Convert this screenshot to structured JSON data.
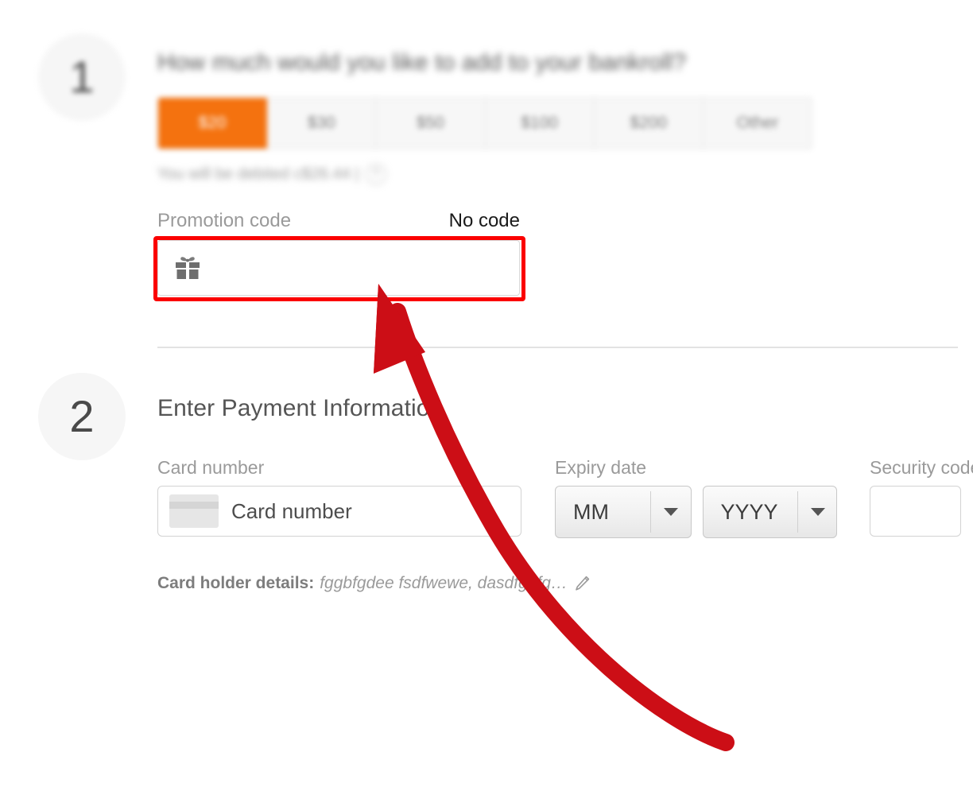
{
  "steps": [
    {
      "number": "1",
      "title": "How much would you like to add to your bankroll?",
      "amounts": [
        {
          "label": "$20",
          "selected": true
        },
        {
          "label": "$30",
          "selected": false
        },
        {
          "label": "$50",
          "selected": false
        },
        {
          "label": "$100",
          "selected": false
        },
        {
          "label": "$200",
          "selected": false
        },
        {
          "label": "Other",
          "selected": false
        }
      ],
      "debit_text": "You will be debited c$26.44 |",
      "info_glyph": "?",
      "promotion": {
        "label": "Promotion code",
        "status": "No code",
        "value": "",
        "placeholder": ""
      }
    },
    {
      "number": "2",
      "title": "Enter Payment Information",
      "card_number": {
        "label": "Card number",
        "placeholder": "Card number",
        "value": ""
      },
      "expiry": {
        "label": "Expiry date",
        "month_value": "MM",
        "year_value": "YYYY"
      },
      "security": {
        "label": "Security code",
        "value": ""
      },
      "holder": {
        "label": "Card holder details:",
        "value": "fggbfgdee fsdfwewe, dasdfg, fg…"
      }
    }
  ],
  "annotation": {
    "color": "#CC0E16",
    "highlight_color": "#FB0000",
    "target": "promotion-code-input"
  },
  "colors": {
    "accent_orange": "#F4720F",
    "annotation_red": "#CC0E16",
    "highlight_red": "#FB0000",
    "text_gray": "#9A9A9A",
    "heading_gray": "#555555"
  }
}
